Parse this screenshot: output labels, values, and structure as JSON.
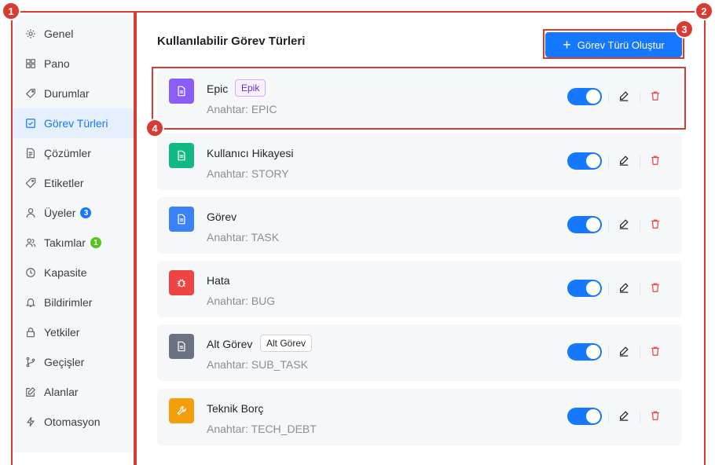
{
  "sidebar": {
    "items": [
      {
        "label": "Genel",
        "icon": "gear-icon"
      },
      {
        "label": "Pano",
        "icon": "grid-icon"
      },
      {
        "label": "Durumlar",
        "icon": "tag-icon"
      },
      {
        "label": "Görev Türleri",
        "icon": "checkbox-icon",
        "active": true
      },
      {
        "label": "Çözümler",
        "icon": "document-icon"
      },
      {
        "label": "Etiketler",
        "icon": "label-icon"
      },
      {
        "label": "Üyeler",
        "icon": "user-icon",
        "badge": "3",
        "badge_color": "#1677ff"
      },
      {
        "label": "Takımlar",
        "icon": "team-icon",
        "badge": "1",
        "badge_color": "#52c41a"
      },
      {
        "label": "Kapasite",
        "icon": "clock-icon"
      },
      {
        "label": "Bildirimler",
        "icon": "bell-icon"
      },
      {
        "label": "Yetkiler",
        "icon": "lock-icon"
      },
      {
        "label": "Geçişler",
        "icon": "branch-icon"
      },
      {
        "label": "Alanlar",
        "icon": "form-icon"
      },
      {
        "label": "Otomasyon",
        "icon": "lightning-icon"
      }
    ]
  },
  "main": {
    "title": "Kullanılabilir Görev Türleri",
    "create_button": "Görev Türü Oluştur",
    "types": [
      {
        "name": "Epic",
        "key": "Anahtar: EPIC",
        "tag": "Epik",
        "color": "#8b5cf6",
        "icon": "document-icon",
        "enabled": true
      },
      {
        "name": "Kullanıcı Hikayesi",
        "key": "Anahtar: STORY",
        "tag": "",
        "color": "#10b981",
        "icon": "document-icon",
        "enabled": true
      },
      {
        "name": "Görev",
        "key": "Anahtar: TASK",
        "tag": "",
        "color": "#3b82f6",
        "icon": "document-icon",
        "enabled": true
      },
      {
        "name": "Hata",
        "key": "Anahtar: BUG",
        "tag": "",
        "color": "#ef4444",
        "icon": "bug-icon",
        "enabled": true
      },
      {
        "name": "Alt Görev",
        "key": "Anahtar: SUB_TASK",
        "tag": "Alt Görev",
        "color": "#6b7280",
        "icon": "document-icon",
        "enabled": true
      },
      {
        "name": "Teknik Borç",
        "key": "Anahtar: TECH_DEBT",
        "tag": "",
        "color": "#f59e0b",
        "icon": "wrench-icon",
        "enabled": true
      }
    ]
  },
  "annotations": [
    "1",
    "2",
    "3",
    "4"
  ],
  "colors": {
    "accent": "#1677ff",
    "annotation": "#d93a31",
    "delete": "#e5484d"
  }
}
